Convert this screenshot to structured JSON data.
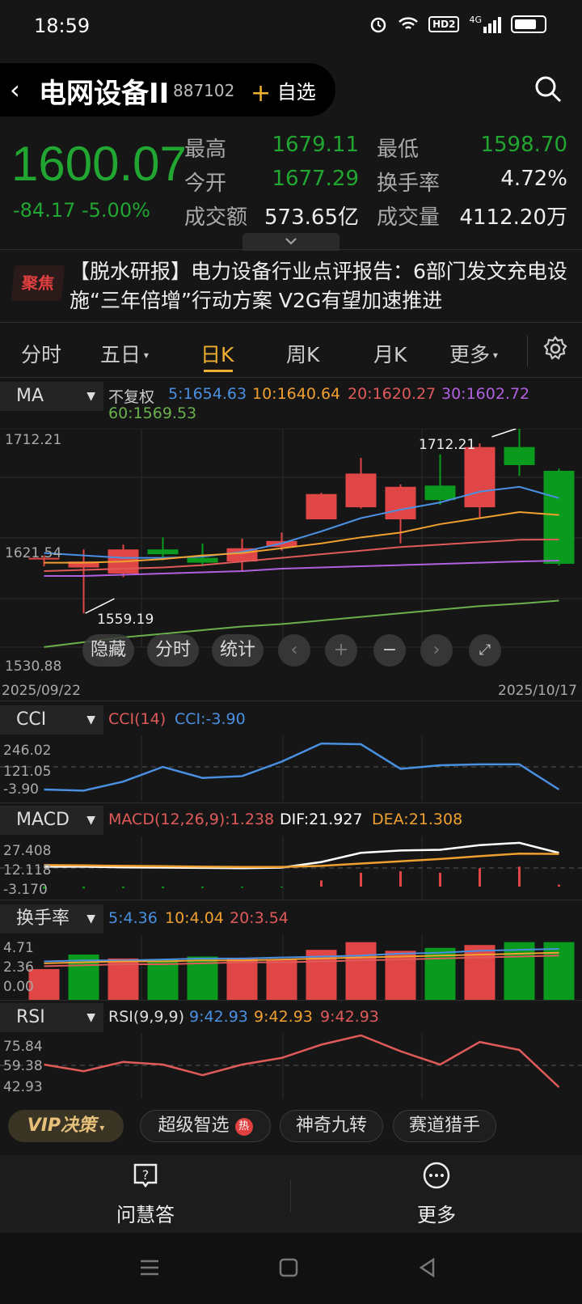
{
  "status_bar": {
    "time": "18:59",
    "network": "4G",
    "hd": "HD2",
    "icons": [
      "alarm-icon",
      "wifi-icon",
      "hd-icon",
      "signal-icon",
      "battery-icon"
    ]
  },
  "header": {
    "back": "‹",
    "title": "电网设备II",
    "code": "887102",
    "watch_plus": "+",
    "watch_label": "自选"
  },
  "quote": {
    "price": "1600.07",
    "change": "-84.17  -5.00%",
    "rows": [
      {
        "l1": "最高",
        "v1": "1679.11",
        "l2": "最低",
        "v2": "1598.70"
      },
      {
        "l1": "今开",
        "v1": "1677.29",
        "l2": "换手率",
        "v2": "4.72%"
      },
      {
        "l1": "成交额",
        "v1": "573.65亿",
        "l2": "成交量",
        "v2": "4112.20万"
      }
    ]
  },
  "news": {
    "badge": "聚焦",
    "text": "【脱水研报】电力设备行业点评报告：6部门发文充电设施“三年倍增”行动方案 V2G有望加速推进"
  },
  "tabs": [
    "分时",
    "五日",
    "日K",
    "周K",
    "月K",
    "更多"
  ],
  "active_tab": "日K",
  "ma": {
    "selector": "MA",
    "mode": "不复权",
    "labels": [
      "5:1654.63",
      "10:1640.64",
      "20:1620.27",
      "30:1602.72",
      "60:1569.53"
    ],
    "colors": [
      "#4a90e2",
      "#f0a030",
      "#e05a5a",
      "#b060e0",
      "#6ab04c"
    ]
  },
  "kline": {
    "y_top": "1712.21",
    "y_mid": "1621.54",
    "y_bot": "1530.88",
    "date_start": "2025/09/22",
    "date_end": "2025/10/17",
    "high_marker": "1712.21",
    "low_marker": "1559.19",
    "controls": [
      "隐藏",
      "分时",
      "统计"
    ]
  },
  "cci": {
    "selector": "CCI",
    "label1": "CCI(14)",
    "label2": "CCI:-3.90",
    "ticks": [
      "246.02",
      "121.05",
      "-3.90"
    ]
  },
  "macd": {
    "selector": "MACD",
    "label1": "MACD(12,26,9):1.238",
    "label2": "DIF:21.927",
    "label3": "DEA:21.308",
    "ticks": [
      "27.408",
      "12.118",
      "-3.170"
    ]
  },
  "turnover": {
    "selector": "换手率",
    "label1": "5:4.36",
    "label2": "10:4.04",
    "label3": "20:3.54",
    "ticks": [
      "4.71",
      "2.36",
      "0.00"
    ]
  },
  "rsi": {
    "selector": "RSI",
    "label1": "RSI(9,9,9)",
    "label2": "9:42.93",
    "label3": "9:42.93",
    "label4": "9:42.93",
    "ticks": [
      "75.84",
      "59.38",
      "42.93"
    ]
  },
  "chips": {
    "vip": "VIP决策",
    "c1": "超级智选",
    "hot": "热",
    "c2": "神奇九转",
    "c3": "赛道猎手"
  },
  "bottom_nav": {
    "ask": "问慧答",
    "more": "更多"
  },
  "chart_data": {
    "type": "candlestick",
    "y_range": [
      1530.88,
      1712.21
    ],
    "candles": [
      {
        "o": 1605,
        "c": 1605,
        "h": 1607,
        "l": 1598
      },
      {
        "o": 1597,
        "c": 1602,
        "h": 1612,
        "l": 1559
      },
      {
        "o": 1592,
        "c": 1612,
        "h": 1616,
        "l": 1589
      },
      {
        "o": 1612,
        "c": 1608,
        "h": 1622,
        "l": 1603
      },
      {
        "o": 1605,
        "c": 1601,
        "h": 1617,
        "l": 1598
      },
      {
        "o": 1602,
        "c": 1613,
        "h": 1621,
        "l": 1594
      },
      {
        "o": 1614,
        "c": 1619,
        "h": 1626,
        "l": 1611
      },
      {
        "o": 1637,
        "c": 1658,
        "h": 1659,
        "l": 1637
      },
      {
        "o": 1647,
        "c": 1675,
        "h": 1688,
        "l": 1646
      },
      {
        "o": 1637,
        "c": 1664,
        "h": 1666,
        "l": 1617
      },
      {
        "o": 1665,
        "c": 1653,
        "h": 1691,
        "l": 1649
      },
      {
        "o": 1647,
        "c": 1697,
        "h": 1700,
        "l": 1638
      },
      {
        "o": 1697,
        "c": 1682,
        "h": 1712.21,
        "l": 1673
      },
      {
        "o": 1677.29,
        "c": 1600.07,
        "h": 1679.11,
        "l": 1598.7
      }
    ],
    "ma_series": {
      "5": [
        1609,
        1607,
        1605,
        1605,
        1606,
        1610,
        1617,
        1627,
        1638,
        1645,
        1651,
        1660,
        1664,
        1654.63
      ],
      "10": [
        1601,
        1601,
        1602,
        1604,
        1607,
        1609,
        1613,
        1617,
        1622,
        1626,
        1633,
        1638,
        1643,
        1640.64
      ],
      "20": [
        1594,
        1595,
        1596,
        1597,
        1599,
        1602,
        1605,
        1608,
        1611,
        1614,
        1616,
        1618,
        1620,
        1620.27
      ],
      "30": [
        1590,
        1590,
        1591,
        1592,
        1593,
        1594,
        1596,
        1597,
        1598,
        1599,
        1600,
        1601,
        1602,
        1602.72
      ],
      "60": [
        1531,
        1535,
        1539,
        1542,
        1545,
        1548,
        1550,
        1553,
        1556,
        1559,
        1562,
        1565,
        1567,
        1569.53
      ]
    },
    "cci_series": [
      -3.9,
      -10,
      40,
      121,
      60,
      70,
      150,
      250,
      246,
      110,
      130,
      135,
      135,
      -3.9
    ],
    "cci_range": [
      -3.9,
      246.02
    ],
    "dif_series": [
      13,
      13,
      12.5,
      12.4,
      12.2,
      12.0,
      12.4,
      16,
      22,
      23.5,
      24,
      27,
      28.5,
      21.927
    ],
    "dea_series": [
      14,
      13.8,
      13.5,
      13.3,
      13.0,
      12.8,
      12.8,
      13.5,
      15,
      16.5,
      18,
      19.8,
      21.5,
      21.308
    ],
    "macd_hist": [
      -1.5,
      -1.2,
      -1.0,
      -1.0,
      -0.9,
      -0.8,
      -0.6,
      4,
      9,
      10,
      9,
      12,
      13,
      1.238
    ],
    "macd_range": [
      -3.17,
      27.408
    ],
    "turnover_vals": [
      3.2,
      4.71,
      4.3,
      4.2,
      4.5,
      4.3,
      4.2,
      5.2,
      6.0,
      5.1,
      5.4,
      5.7,
      6.0,
      6.0
    ],
    "turnover_up": [
      true,
      false,
      true,
      false,
      false,
      true,
      true,
      true,
      true,
      true,
      false,
      true,
      false,
      false
    ],
    "turnover_ma": {
      "5": [
        4.0,
        4.1,
        4.1,
        4.2,
        4.3,
        4.3,
        4.4,
        4.5,
        4.6,
        4.8,
        4.9,
        5.1,
        5.2,
        5.3
      ],
      "10": [
        3.8,
        3.9,
        4.0,
        4.0,
        4.1,
        4.1,
        4.2,
        4.3,
        4.4,
        4.5,
        4.6,
        4.7,
        4.8,
        4.9
      ],
      "20": [
        3.5,
        3.6,
        3.7,
        3.7,
        3.8,
        3.9,
        3.9,
        4.0,
        4.1,
        4.2,
        4.3,
        4.4,
        4.5,
        4.6
      ]
    },
    "turnover_range": [
      0,
      4.71
    ],
    "rsi_series": [
      60,
      55,
      62,
      60,
      52,
      60,
      65,
      75,
      82,
      70,
      60,
      77,
      71,
      42.93
    ],
    "rsi_range": [
      42.93,
      75.84
    ]
  }
}
